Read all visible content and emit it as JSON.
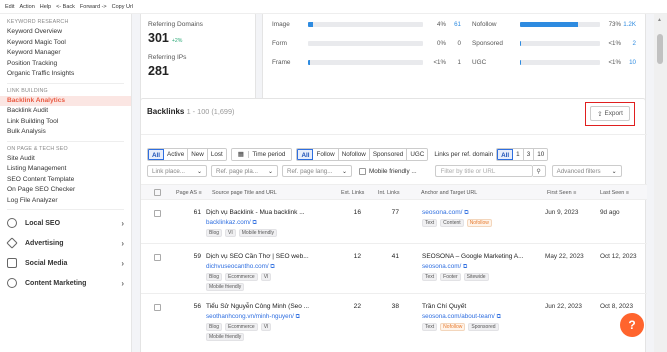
{
  "menubar": [
    "Edit",
    "Action",
    "Help",
    "<- Back",
    "Forward ->",
    "Copy Url"
  ],
  "sidebar": {
    "keyword_head": "KEYWORD RESEARCH",
    "keyword_items": [
      "Keyword Overview",
      "Keyword Magic Tool",
      "Keyword Manager",
      "Position Tracking",
      "Organic Traffic Insights"
    ],
    "link_head": "LINK BUILDING",
    "link_items": [
      "Backlink Analytics",
      "Backlink Audit",
      "Link Building Tool",
      "Bulk Analysis"
    ],
    "onpage_head": "ON PAGE & TECH SEO",
    "onpage_items": [
      "Site Audit",
      "Listing Management",
      "SEO Content Template",
      "On Page SEO Checker",
      "Log File Analyzer"
    ],
    "groups": [
      {
        "label": "Local SEO",
        "icon": "location-icon"
      },
      {
        "label": "Advertising",
        "icon": "advertising-icon"
      },
      {
        "label": "Social Media",
        "icon": "social-media-icon"
      },
      {
        "label": "Content Marketing",
        "icon": "content-marketing-icon"
      }
    ]
  },
  "summary": {
    "ref_domains_label": "Referring Domains",
    "ref_domains_value": "301",
    "ref_domains_change": "+2%",
    "ref_ips_label": "Referring IPs",
    "ref_ips_value": "281",
    "types": [
      {
        "label": "Image",
        "pct": "4%",
        "count": "61",
        "fill": 0.04
      },
      {
        "label": "Form",
        "pct": "0%",
        "count": "0",
        "fill": 0.0
      },
      {
        "label": "Frame",
        "pct": "<1%",
        "count": "1",
        "fill": 0.005
      }
    ],
    "attrs": [
      {
        "label": "Nofollow",
        "pct": "73%",
        "count": "1.2K",
        "fill": 0.73
      },
      {
        "label": "Sponsored",
        "pct": "<1%",
        "count": "2",
        "fill": 0.005
      },
      {
        "label": "UGC",
        "pct": "<1%",
        "count": "10",
        "fill": 0.005
      }
    ]
  },
  "backlinks": {
    "title": "Backlinks",
    "range": "1 - 100 (1,699)",
    "export_label": "Export",
    "type_filters": [
      "All",
      "Active",
      "New",
      "Lost"
    ],
    "time_period": "Time period",
    "follow_filters": [
      "All",
      "Follow",
      "Nofollow",
      "Sponsored",
      "UGC"
    ],
    "per_domain_label": "Links per ref. domain",
    "per_domain": [
      "All",
      "1",
      "3",
      "10"
    ],
    "link_placement": "Link place...",
    "ref_page_platform": "Ref. page pla...",
    "ref_page_language": "Ref. page lang...",
    "mobile_friendly": "Mobile friendly ...",
    "search_placeholder": "Filter by title or URL",
    "advanced_filters": "Advanced filters",
    "columns": [
      "Page AS",
      "Source page Title and URL",
      "Ext. Links",
      "Int. Links",
      "Anchor and Target URL",
      "First Seen",
      "Last Seen"
    ],
    "rows": [
      {
        "as": "61",
        "title": "Dịch vụ Backlink - Mua backlink ...",
        "url": "backlinkaz.com/",
        "tags": [
          "Blog",
          "VI",
          "Mobile friendly"
        ],
        "ext": "16",
        "int": "77",
        "anchor": "seosona.com/",
        "target_tags": [
          "Text",
          "Content",
          "Nofollow"
        ],
        "first": "Jun 9, 2023",
        "last": "9d ago"
      },
      {
        "as": "59",
        "title": "Dịch vụ SEO Cần Thơ | SEO web...",
        "url": "dichvuseocantho.com/",
        "tags": [
          "Blog",
          "Ecommerce",
          "VI",
          "Mobile friendly"
        ],
        "ext": "12",
        "int": "41",
        "anchor": "SEOSONA – Google Marketing A...",
        "target": "seosona.com/",
        "target_tags": [
          "Text",
          "Footer",
          "Sitewide"
        ],
        "first": "May 22, 2023",
        "last": "Oct 12, 2023"
      },
      {
        "as": "56",
        "title": "Tiểu Sử Nguyễn Công Minh (Seo ...",
        "url": "seothanhcong.vn/minh-nguyen/",
        "tags": [
          "Blog",
          "Ecommerce",
          "VI",
          "Mobile friendly"
        ],
        "ext": "22",
        "int": "38",
        "anchor": "Trần Chí Quyết",
        "target": "seosona.com/about-team/",
        "target_tags": [
          "Text",
          "Nofollow",
          "Sponsored"
        ],
        "first": "Jun 22, 2023",
        "last": "Oct 8, 2023"
      }
    ]
  },
  "help_label": "?"
}
